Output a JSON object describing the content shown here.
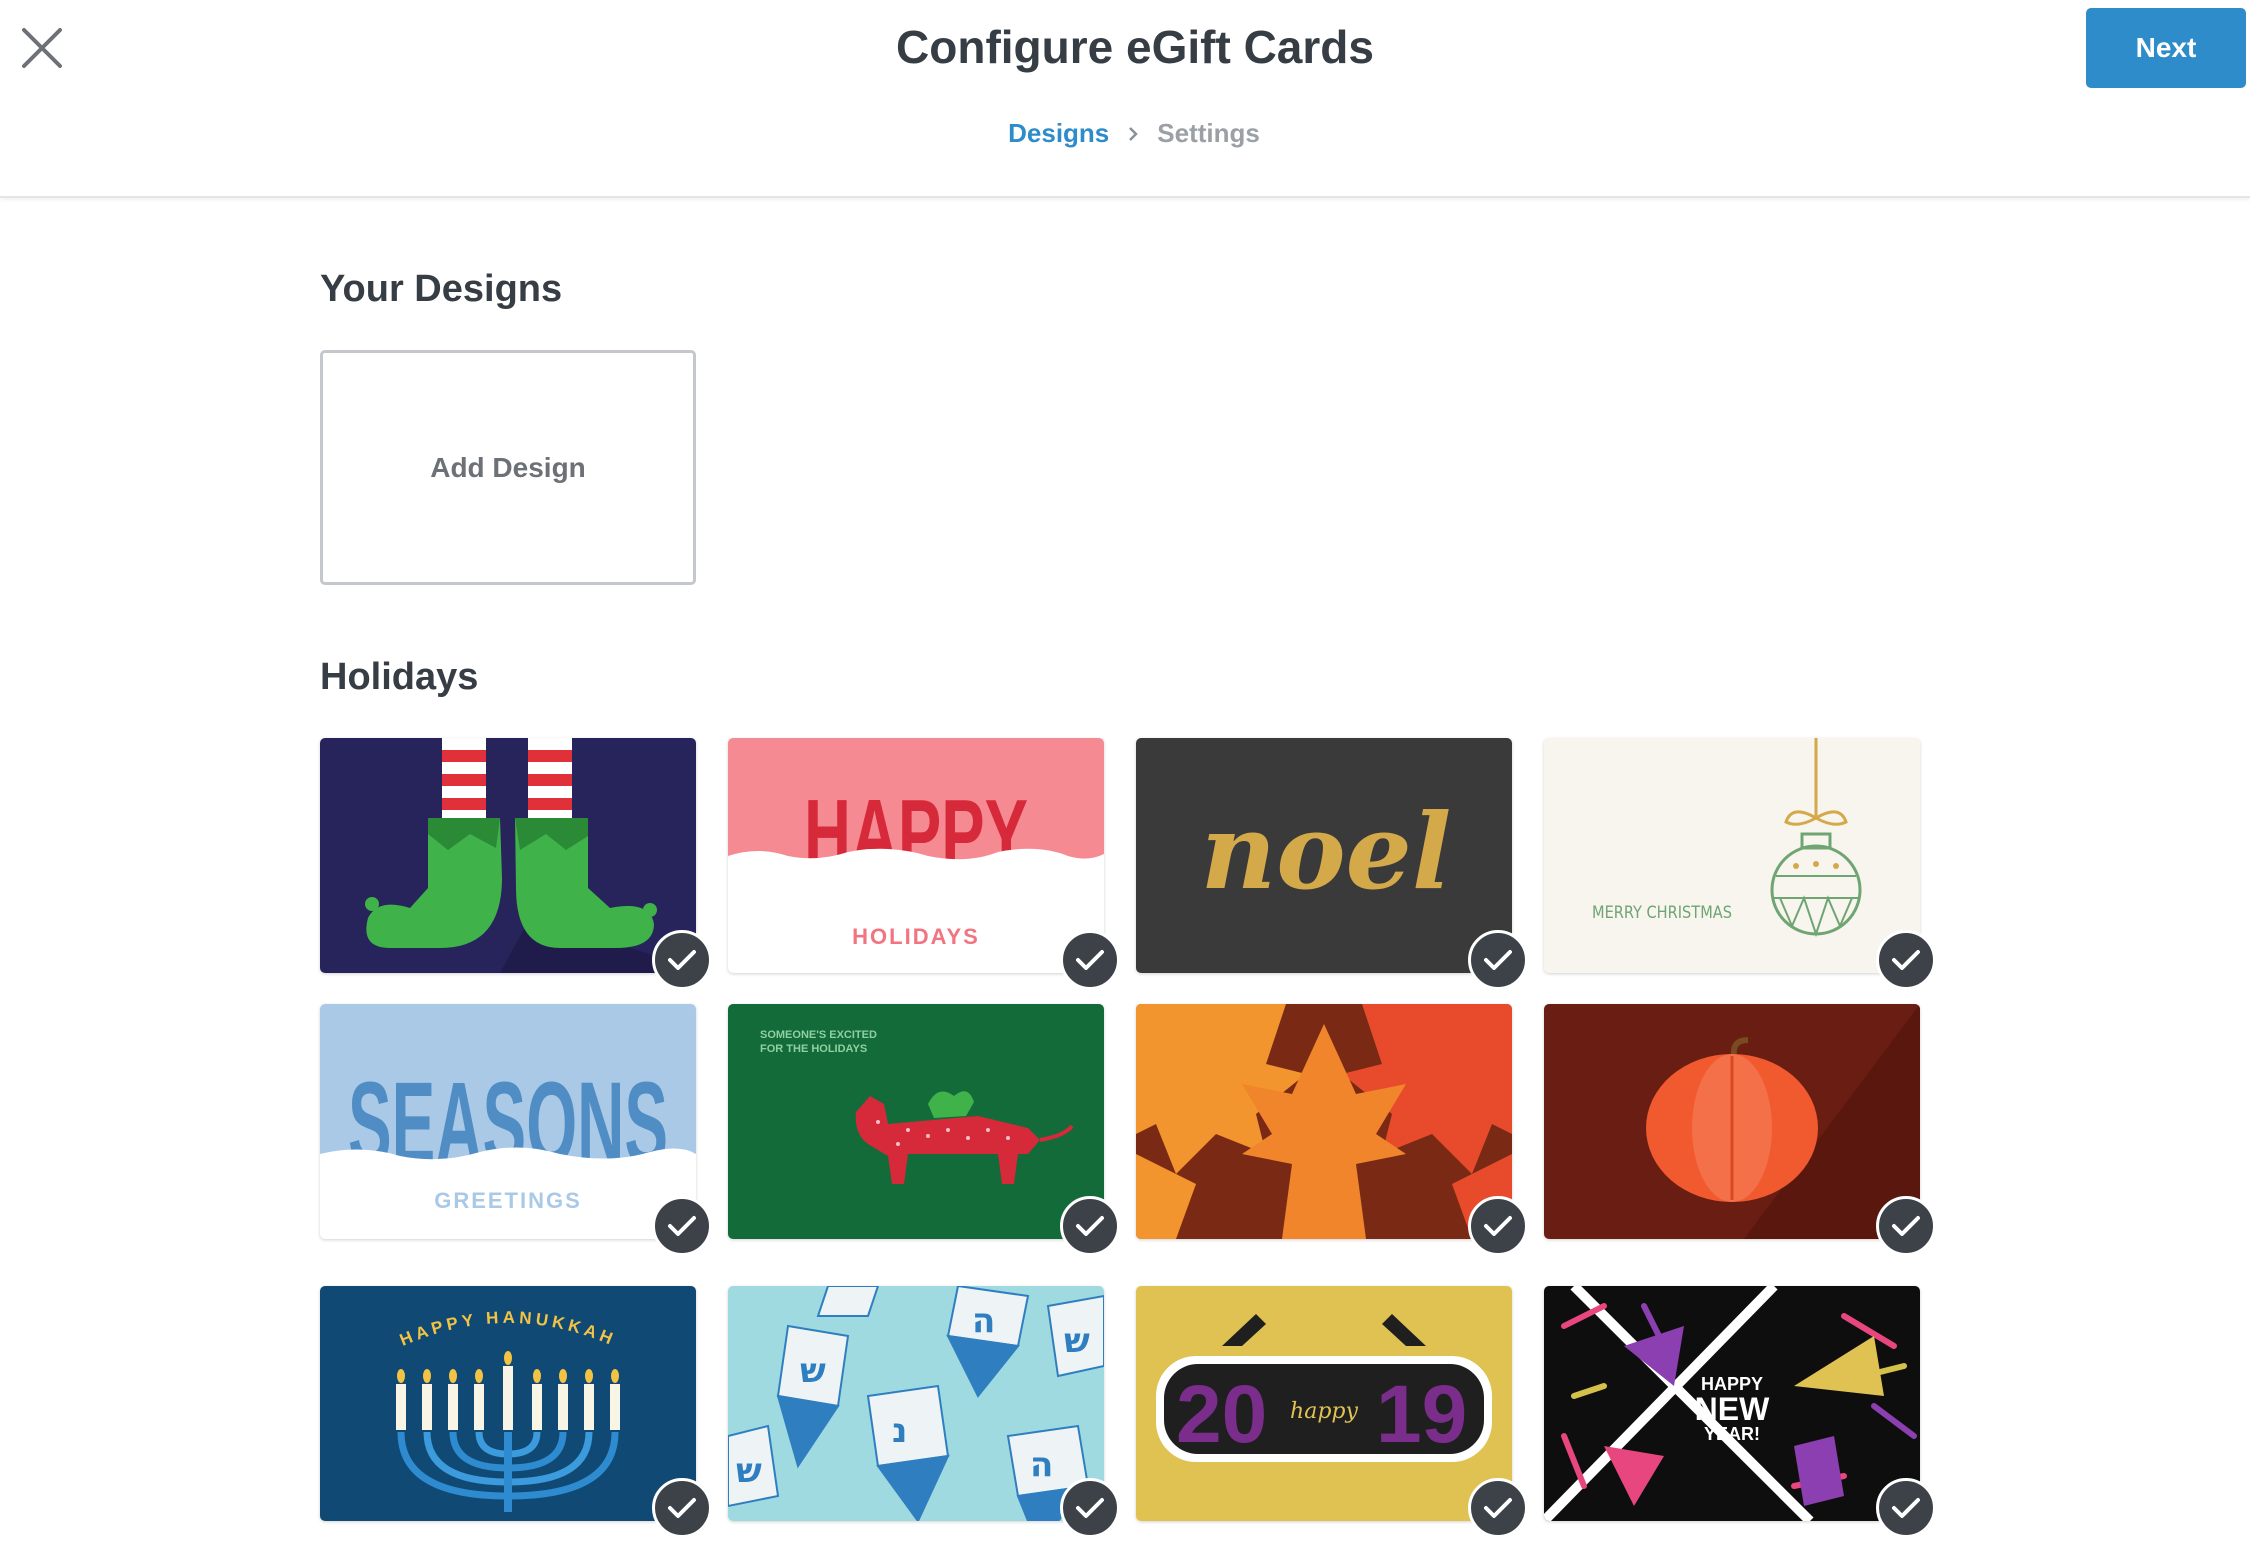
{
  "header": {
    "title": "Configure eGift Cards",
    "next_label": "Next",
    "breadcrumb": {
      "active": "Designs",
      "inactive": "Settings"
    }
  },
  "your_designs": {
    "title": "Your Designs",
    "add_label": "Add Design"
  },
  "holidays": {
    "title": "Holidays",
    "cards": [
      {
        "name": "elf-feet",
        "selected": true
      },
      {
        "name": "happy-holidays",
        "selected": true,
        "text_top": "HAPPY",
        "text_bottom": "HOLIDAYS"
      },
      {
        "name": "noel",
        "selected": true,
        "text": "noel"
      },
      {
        "name": "merry-christmas",
        "selected": true,
        "text": "MERRY CHRISTMAS"
      },
      {
        "name": "seasons-greetings",
        "selected": true,
        "text_top": "SEASONS",
        "text_bottom": "GREETINGS"
      },
      {
        "name": "dachshund",
        "selected": true,
        "text_line1": "SOMEONE'S EXCITED",
        "text_line2": "FOR THE HOLIDAYS"
      },
      {
        "name": "autumn-leaves",
        "selected": true
      },
      {
        "name": "pumpkin",
        "selected": true
      },
      {
        "name": "happy-hanukkah",
        "selected": true,
        "text": "HAPPY HANUKKAH"
      },
      {
        "name": "dreidels",
        "selected": true
      },
      {
        "name": "2019",
        "selected": true,
        "text_left": "20",
        "text_mid": "happy",
        "text_right": "19"
      },
      {
        "name": "happy-new-year",
        "selected": true,
        "text_line1": "HAPPY",
        "text_line2": "NEW",
        "text_line3": "YEAR!"
      }
    ]
  },
  "colors": {
    "accent": "#2d8cc9",
    "text": "#373d44",
    "check_bg": "#3c4248"
  }
}
